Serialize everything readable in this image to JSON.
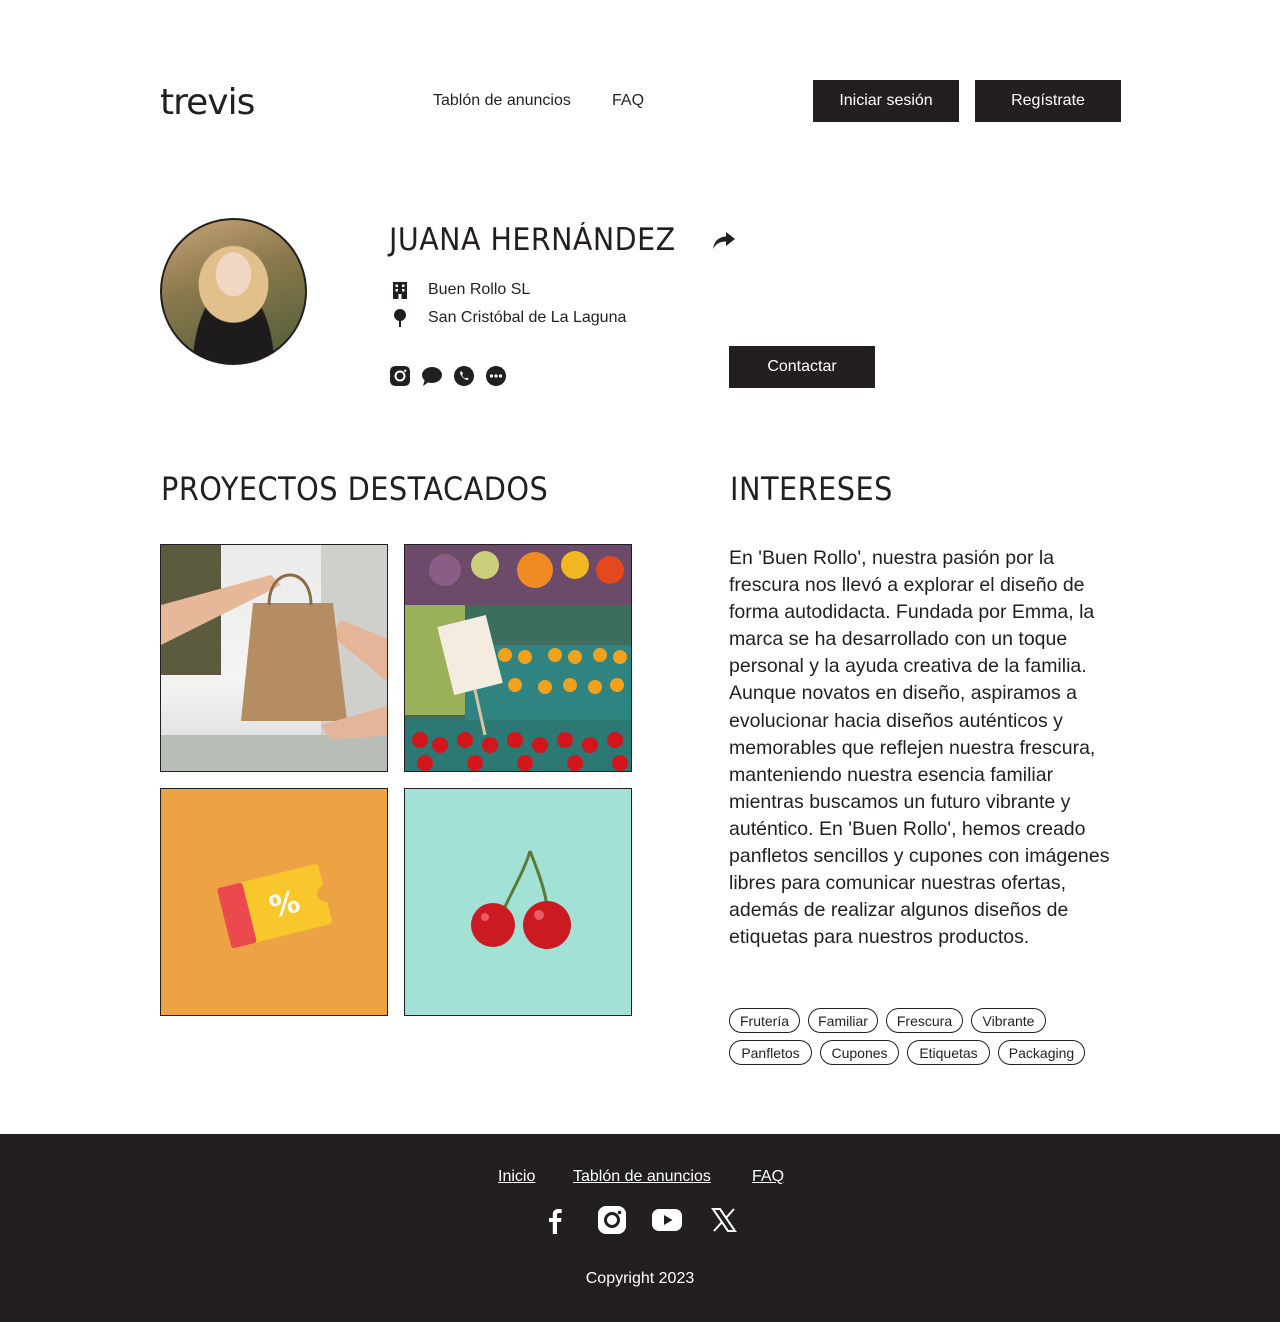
{
  "header": {
    "logo": "trevis",
    "nav": [
      "Tablón de anuncios",
      "FAQ"
    ],
    "login_label": "Iniciar sesión",
    "register_label": "Regístrate"
  },
  "profile": {
    "name": "JUANA HERNÁNDEZ",
    "company": "Buen Rollo SL",
    "location": "San Cristóbal de La Laguna",
    "contact_label": "Contactar",
    "social_icons": [
      "instagram-icon",
      "chat-bubble-icon",
      "whatsapp-icon",
      "more-icon"
    ]
  },
  "projects": {
    "title": "PROYECTOS DESTACADOS",
    "images": [
      "shopping-bag-handoff",
      "fresh-produce-market",
      "discount-coupon",
      "cherries"
    ]
  },
  "interests": {
    "title": "INTERESES",
    "text": "En 'Buen Rollo', nuestra pasión por la frescura nos llevó a explorar el diseño de forma autodidacta. Fundada por Emma, la marca se ha desarrollado con un toque personal y la ayuda creativa de la familia. Aunque novatos en diseño, aspiramos a evolucionar hacia diseños auténticos y memorables que reflejen nuestra frescura, manteniendo nuestra esencia familiar mientras buscamos un futuro vibrante y auténtico. En 'Buen Rollo', hemos creado panfletos sencillos y cupones con imágenes libres para comunicar nuestras ofertas, además de realizar algunos diseños de etiquetas para nuestros productos.",
    "tags": [
      "Frutería",
      "Familiar",
      "Frescura",
      "Vibrante",
      "Panfletos",
      "Cupones",
      "Etiquetas",
      "Packaging"
    ]
  },
  "footer": {
    "links": [
      "Inicio",
      "Tablón de anuncios",
      "FAQ"
    ],
    "social_icons": [
      "facebook-icon",
      "instagram-icon",
      "youtube-icon",
      "x-icon"
    ],
    "copyright": "Copyright 2023"
  },
  "colors": {
    "primary": "#231f20",
    "background": "#ffffff",
    "coupon_bg": "#eda243",
    "cherry_bg": "#a2e1d6"
  }
}
